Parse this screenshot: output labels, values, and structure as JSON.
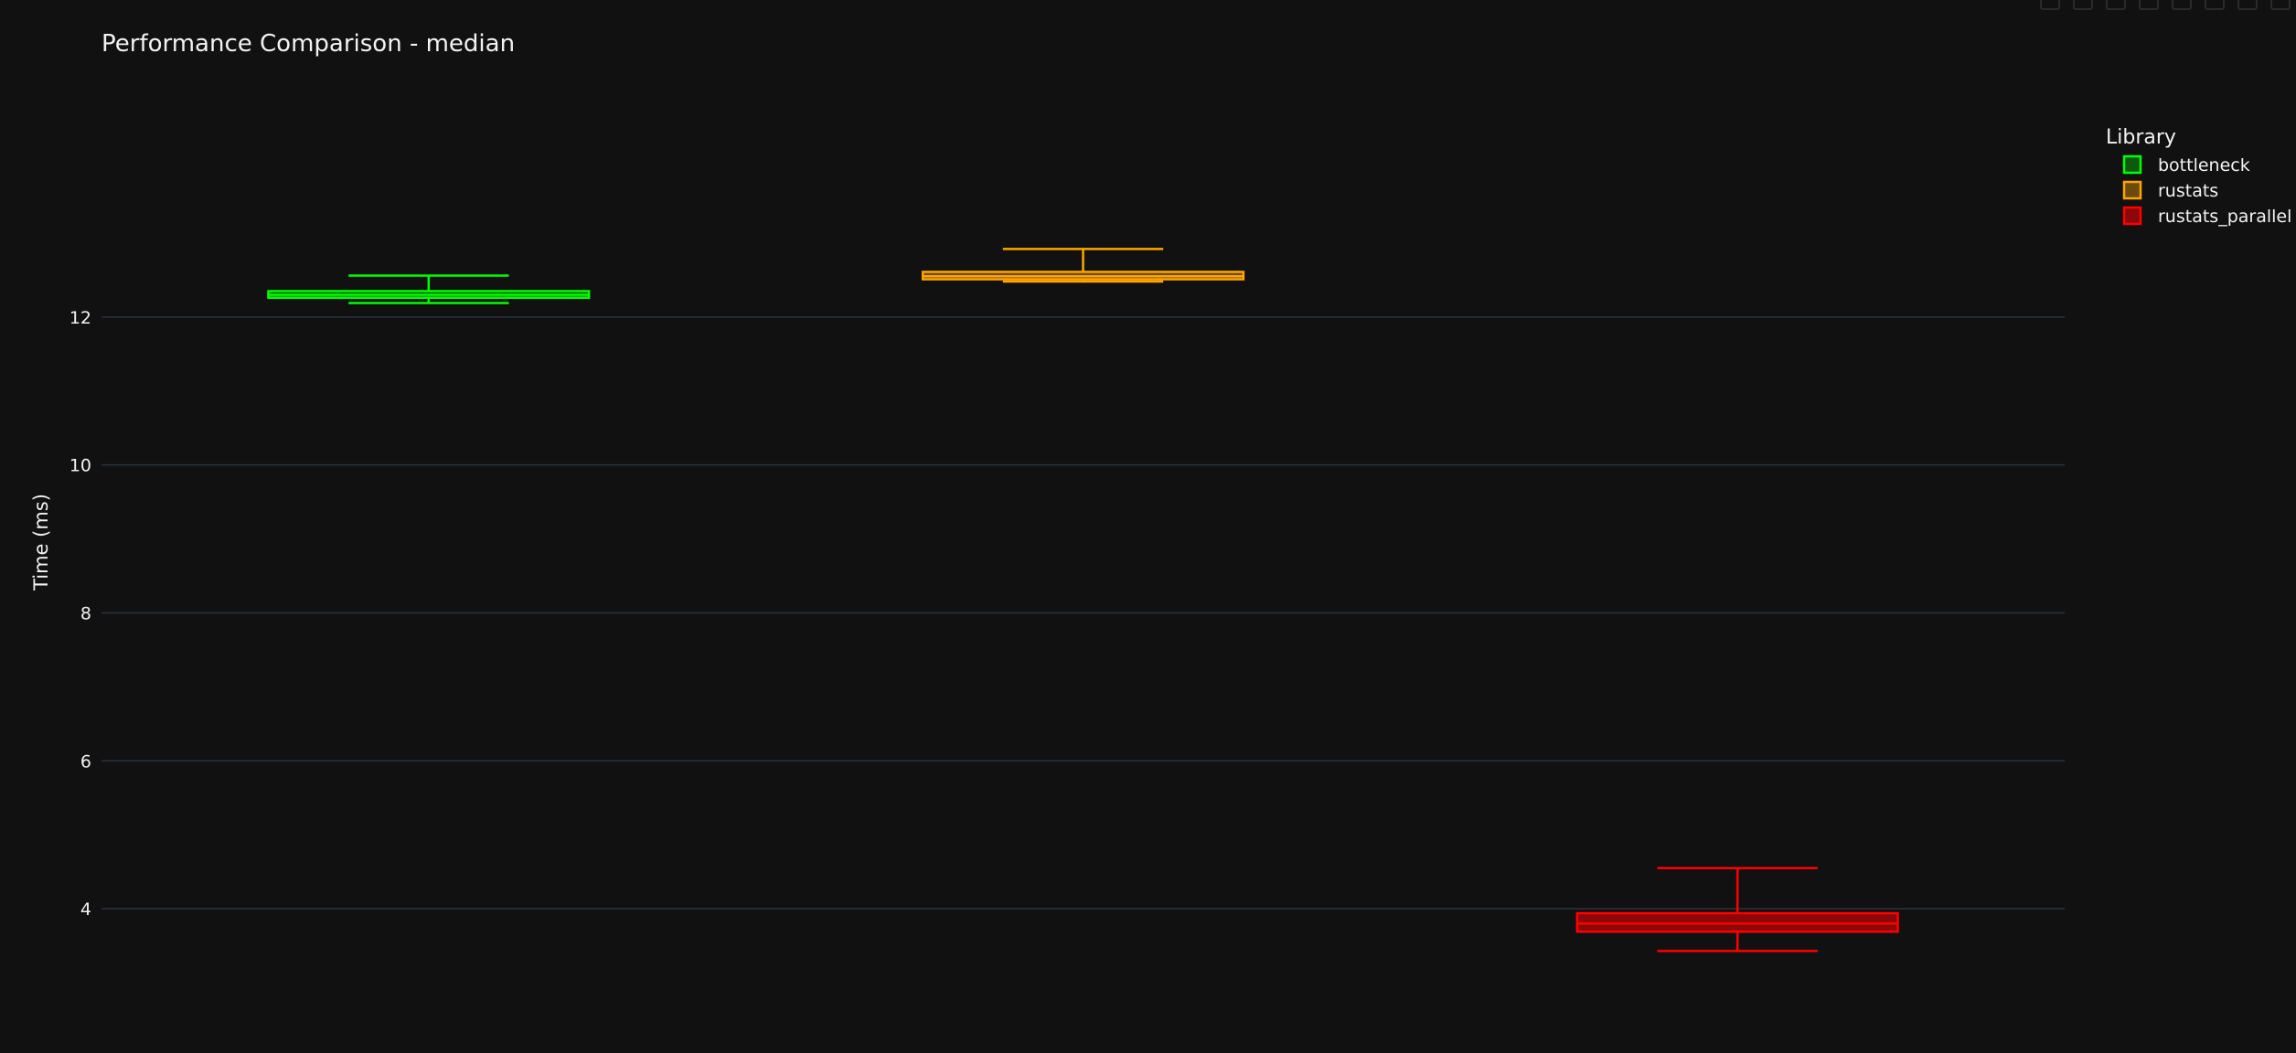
{
  "chart_data": {
    "type": "box",
    "title": "Performance Comparison - median",
    "xlabel": "",
    "ylabel": "Time (ms)",
    "ylim": [
      2.05,
      15.05
    ],
    "yticks": [
      4,
      6,
      8,
      10,
      12
    ],
    "grid": true,
    "legend": {
      "title": "Library",
      "placement": "top-right"
    },
    "series": [
      {
        "name": "bottleneck",
        "color": "#00ff00",
        "fill": "#0d5a0d",
        "min": 12.19,
        "q1": 12.26,
        "median": 12.3,
        "q3": 12.35,
        "max": 12.56
      },
      {
        "name": "rustats",
        "color": "#ffa500",
        "fill": "#6b4a0b",
        "min": 12.48,
        "q1": 12.51,
        "median": 12.55,
        "q3": 12.61,
        "max": 12.92
      },
      {
        "name": "rustats_parallel",
        "color": "#ff0000",
        "fill": "#8a0808",
        "min": 3.43,
        "q1": 3.69,
        "median": 3.8,
        "q3": 3.94,
        "max": 4.55
      }
    ]
  }
}
